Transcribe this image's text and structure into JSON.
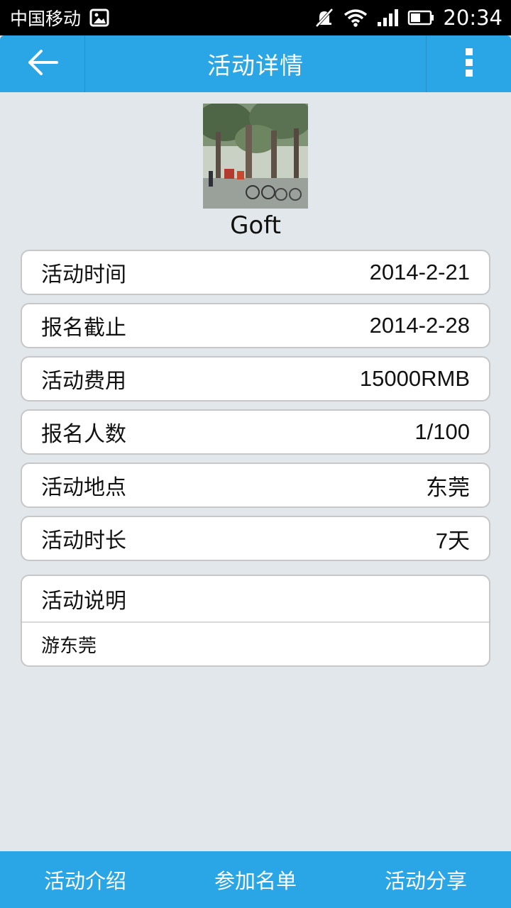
{
  "status_bar": {
    "carrier": "中国移动",
    "time": "20:34",
    "icons": [
      "image-icon",
      "mute-icon",
      "wifi-icon",
      "signal-icon",
      "battery-icon"
    ]
  },
  "app_bar": {
    "title": "活动详情",
    "back_icon": "arrow-left-icon",
    "more_icon": "more-vertical-icon",
    "color": "#2aa6e6"
  },
  "profile": {
    "name": "Goft"
  },
  "details": [
    {
      "label": "活动时间",
      "value": "2014-2-21"
    },
    {
      "label": "报名截止",
      "value": "2014-2-28"
    },
    {
      "label": "活动费用",
      "value": "15000RMB"
    },
    {
      "label": "报名人数",
      "value": "1/100"
    },
    {
      "label": "活动地点",
      "value": "东莞"
    },
    {
      "label": "活动时长",
      "value": "7天"
    }
  ],
  "description": {
    "title": "活动说明",
    "text": "游东莞"
  },
  "tabs": [
    {
      "label": "活动介绍"
    },
    {
      "label": "参加名单"
    },
    {
      "label": "活动分享"
    }
  ]
}
